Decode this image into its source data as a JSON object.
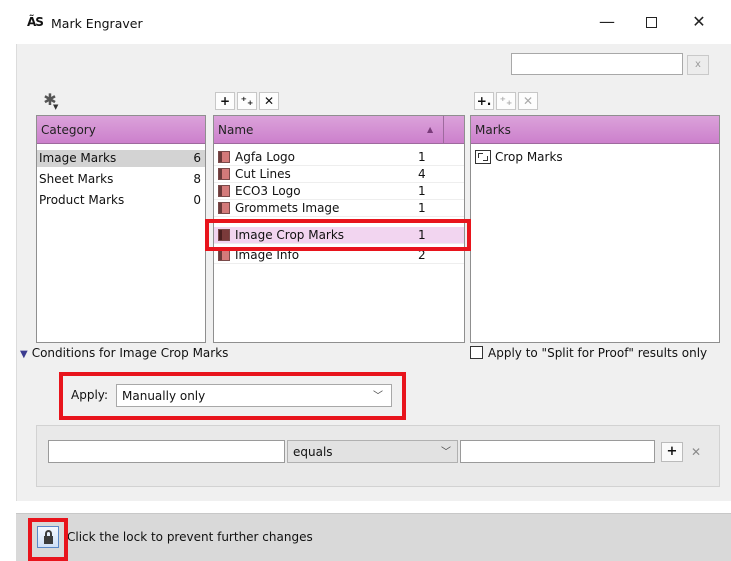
{
  "window": {
    "app_icon": "ÃS",
    "title": "Mark Engraver",
    "minimize_glyph": "—",
    "close_glyph": "✕"
  },
  "search": {
    "value": "",
    "clear_label": "x"
  },
  "category_panel": {
    "toolbar_icon": "gear-icon",
    "header": "Category",
    "rows": [
      {
        "label": "Image Marks",
        "count": "6",
        "selected": true
      },
      {
        "label": "Sheet Marks",
        "count": "8",
        "selected": false
      },
      {
        "label": "Product Marks",
        "count": "0",
        "selected": false
      }
    ]
  },
  "name_panel": {
    "toolbar": {
      "add": "+",
      "add_multi": "⁺₊",
      "remove": "✕"
    },
    "header": "Name",
    "sort_indicator": "▲",
    "rows": [
      {
        "label": "Agfa Logo",
        "count": "1"
      },
      {
        "label": "Cut Lines",
        "count": "4"
      },
      {
        "label": "ECO3 Logo",
        "count": "1"
      },
      {
        "label": "Grommets Image",
        "count": "1"
      },
      {
        "label": "Image Crop Marks",
        "count": "1",
        "selected": true
      },
      {
        "label": "Image Info",
        "count": "2"
      }
    ]
  },
  "marks_panel": {
    "toolbar": {
      "add": "+.",
      "add_multi": "⁺₊",
      "remove": "✕"
    },
    "header": "Marks",
    "rows": [
      {
        "label": "Crop Marks",
        "icon": "crop-marks-icon"
      }
    ]
  },
  "conditions": {
    "label": "Conditions for Image Crop Marks",
    "split_proof_label": "Apply to \"Split for Proof\" results only",
    "split_proof_checked": false,
    "apply_label": "Apply:",
    "apply_value": "Manually only",
    "rule": {
      "field_value": "",
      "operator": "equals",
      "value": "",
      "add_label": "+",
      "remove_label": "✕"
    }
  },
  "status": {
    "lock_icon": "lock-icon",
    "text": "Click the lock to prevent further changes"
  },
  "colors": {
    "header_gradient_top": "#dba2da",
    "header_gradient_bottom": "#cc80cc",
    "selected_row": "#f2d5f0",
    "highlight": "#e8141c"
  }
}
